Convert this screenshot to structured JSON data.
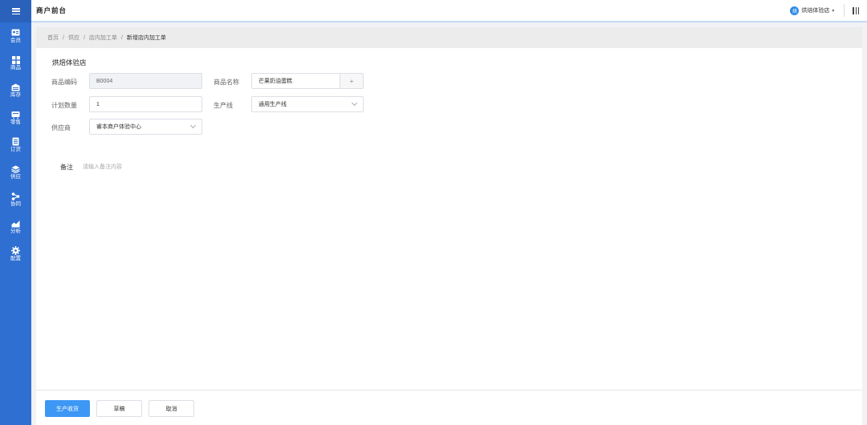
{
  "header": {
    "app_title": "商户前台",
    "store_badge": "烘",
    "store_name": "烘焙体验店"
  },
  "sidebar": {
    "items": [
      {
        "label": "会员",
        "icon": "member-card-icon"
      },
      {
        "label": "商品",
        "icon": "grid-icon"
      },
      {
        "label": "库存",
        "icon": "warehouse-icon"
      },
      {
        "label": "零售",
        "icon": "cart-icon"
      },
      {
        "label": "订货",
        "icon": "order-list-icon"
      },
      {
        "label": "供应",
        "icon": "layers-icon"
      },
      {
        "label": "协同",
        "icon": "collaboration-icon"
      },
      {
        "label": "分析",
        "icon": "chart-icon"
      },
      {
        "label": "配置",
        "icon": "gear-icon"
      }
    ]
  },
  "breadcrumb": {
    "items": [
      "首页",
      "供应",
      "店内加工单"
    ],
    "current": "新增店内加工单",
    "separator": "/"
  },
  "form": {
    "store_heading": "烘焙体验店",
    "product_code_label": "商品编码",
    "product_code_value": "B0004",
    "product_name_label": "商品名称",
    "product_name_value": "芒果奶油蛋糕",
    "add_symbol": "+",
    "plan_qty_label": "计划数量",
    "plan_qty_value": "1",
    "production_line_label": "生产线",
    "production_line_value": "通用生产线",
    "supplier_label": "供应商",
    "supplier_value": "睿本商户体验中心",
    "note_label": "备注",
    "note_placeholder": "请输入备注内容"
  },
  "footer": {
    "produce_receive_label": "生产收货",
    "draft_label": "草稿",
    "cancel_label": "取消"
  },
  "colors": {
    "sidebar": "#2f6fd1",
    "primary": "#3d97f5"
  }
}
